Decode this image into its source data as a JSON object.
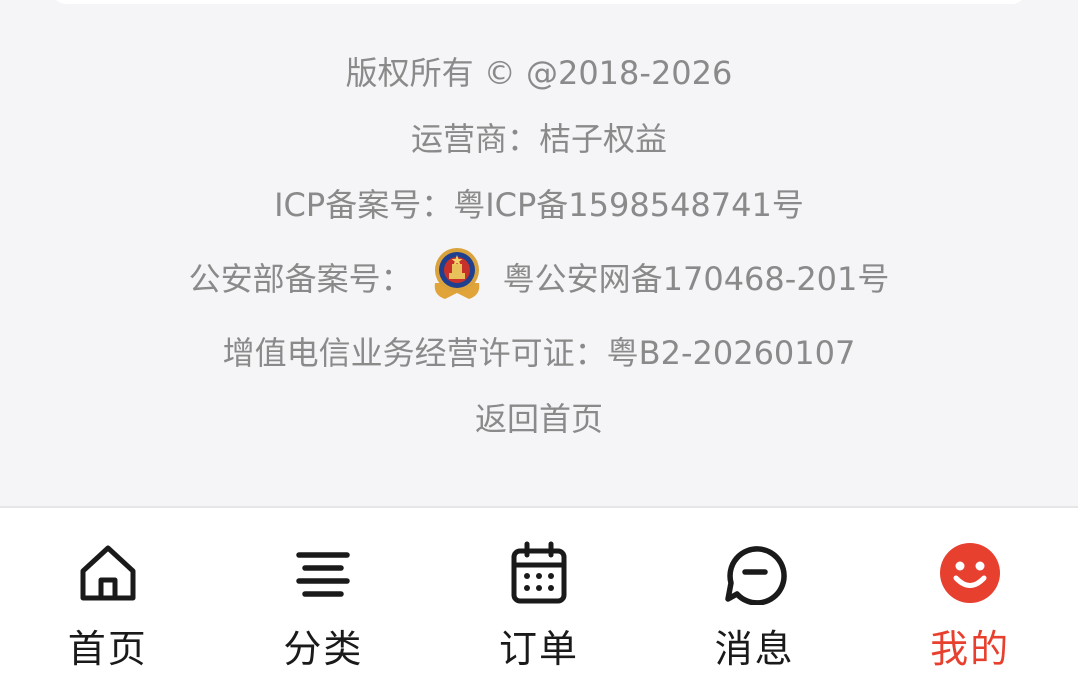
{
  "footer": {
    "copyright": "版权所有 © @2018-2026",
    "operator": "运营商：桔子权益",
    "icp": "ICP备案号：粤ICP备1598548741号",
    "police_label": "公安部备案号：",
    "police_value": "粤公安网备170468-201号",
    "license": "增值电信业务经营许可证：粤B2-20260107",
    "back_home": "返回首页"
  },
  "tabbar": {
    "active_color": "#e8402f",
    "items": [
      {
        "label": "首页",
        "icon": "home-icon"
      },
      {
        "label": "分类",
        "icon": "menu-lines-icon"
      },
      {
        "label": "订单",
        "icon": "calendar-icon"
      },
      {
        "label": "消息",
        "icon": "chat-bubble-icon"
      },
      {
        "label": "我的",
        "icon": "smiley-icon",
        "active": true
      }
    ]
  }
}
